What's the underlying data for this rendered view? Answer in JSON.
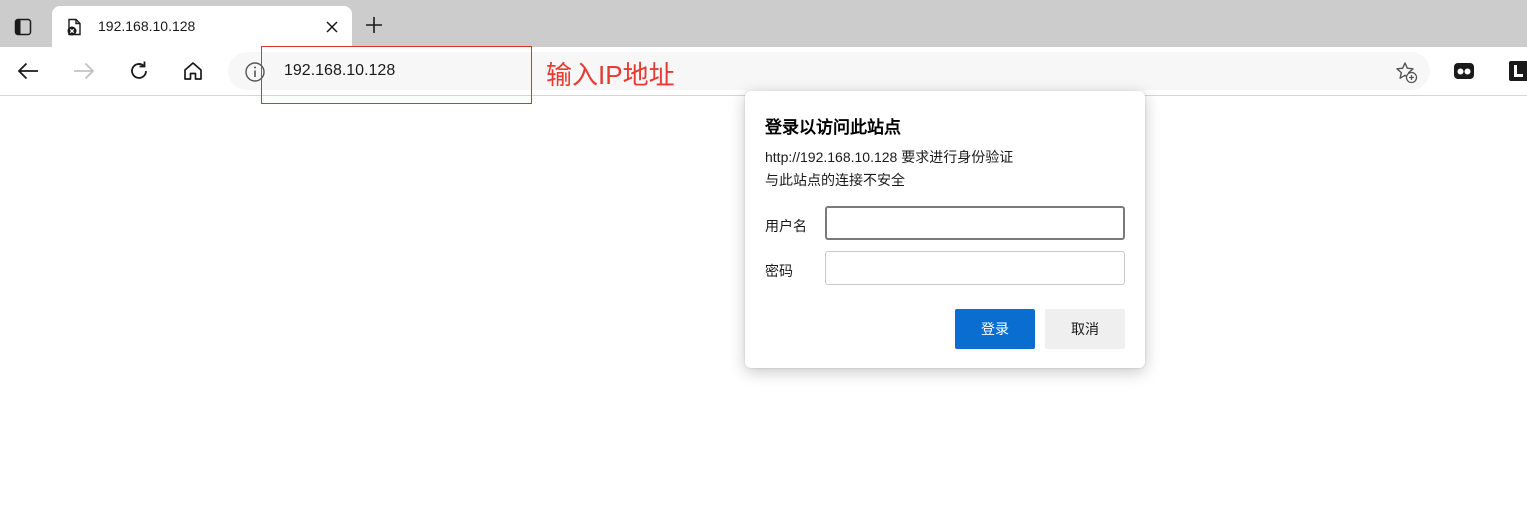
{
  "browser": {
    "tab": {
      "title": "192.168.10.128"
    },
    "address_bar": {
      "url": "192.168.10.128"
    }
  },
  "annotation": {
    "text": "输入IP地址",
    "color": "#e63a32"
  },
  "auth_dialog": {
    "title": "登录以访问此站点",
    "message_line1": "http://192.168.10.128 要求进行身份验证",
    "message_line2": "与此站点的连接不安全",
    "username_label": "用户名",
    "username_value": "",
    "password_label": "密码",
    "password_value": "",
    "login_button": "登录",
    "cancel_button": "取消",
    "accent_color": "#0a6ed1"
  },
  "icons": {
    "tab_actions": "tab-actions-icon",
    "favicon": "insecure-page-icon",
    "close": "close-icon",
    "new_tab": "plus-icon",
    "back": "back-arrow-icon",
    "forward": "forward-arrow-icon",
    "refresh": "refresh-icon",
    "home": "home-icon",
    "info": "info-icon",
    "favorite": "add-favorite-icon"
  }
}
